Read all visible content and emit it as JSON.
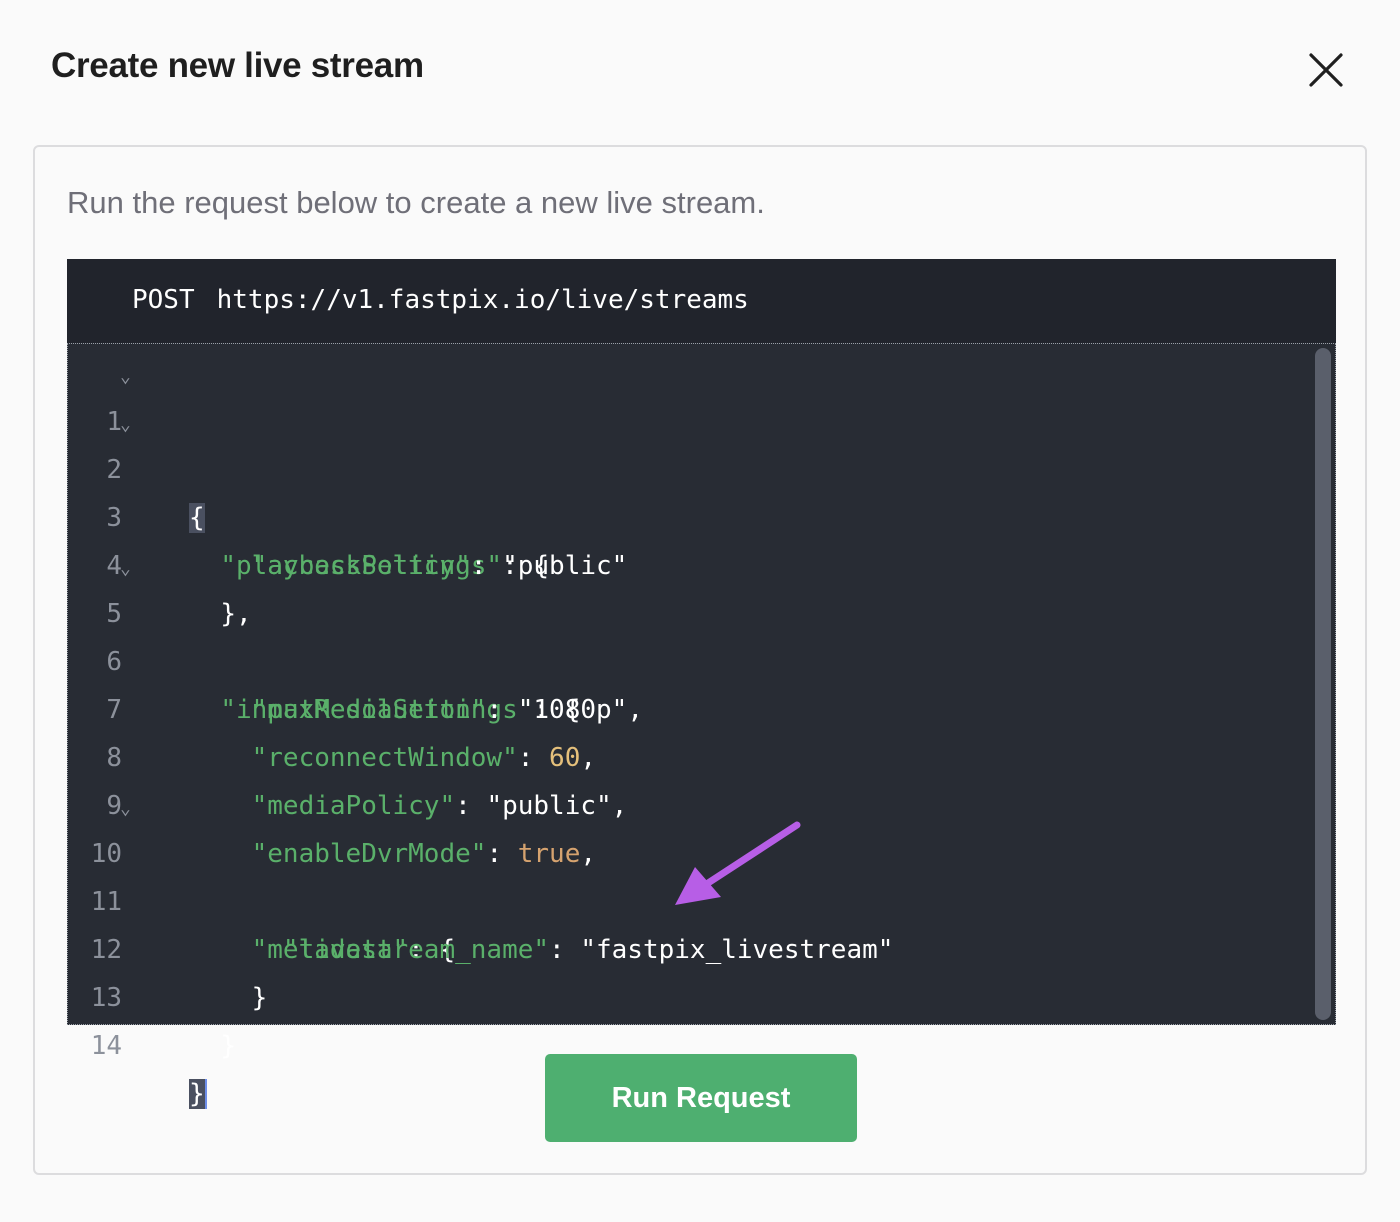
{
  "modal": {
    "title": "Create new live stream",
    "close_icon": "close-icon"
  },
  "panel": {
    "subtitle": "Run the request below to create a new live stream."
  },
  "request": {
    "method": "POST",
    "url": "https://v1.fastpix.io/live/streams"
  },
  "code": {
    "lines": [
      {
        "num": "1",
        "fold": true
      },
      {
        "num": "2",
        "fold": true
      },
      {
        "num": "3",
        "fold": false
      },
      {
        "num": "4",
        "fold": false
      },
      {
        "num": "5",
        "fold": true
      },
      {
        "num": "6",
        "fold": false
      },
      {
        "num": "7",
        "fold": false
      },
      {
        "num": "8",
        "fold": false
      },
      {
        "num": "9",
        "fold": false
      },
      {
        "num": "10",
        "fold": true
      },
      {
        "num": "11",
        "fold": false
      },
      {
        "num": "12",
        "fold": false
      },
      {
        "num": "13",
        "fold": false
      },
      {
        "num": "14",
        "fold": false
      }
    ],
    "tokens": {
      "open_brace": "{",
      "close_brace": "}",
      "playbackSettings_key": "\"playbackSettings\"",
      "accessPolicy_key": "\"accessPolicy\"",
      "accessPolicy_val": "\"public\"",
      "inputMediaSettings_key": "\"inputMediaSettings\"",
      "maxResolution_key": "\"maxResolution\"",
      "maxResolution_val": "\"1080p\"",
      "reconnectWindow_key": "\"reconnectWindow\"",
      "reconnectWindow_val": "60",
      "mediaPolicy_key": "\"mediaPolicy\"",
      "mediaPolicy_val": "\"public\"",
      "enableDvrMode_key": "\"enableDvrMode\"",
      "enableDvrMode_val": "true",
      "metadata_key": "\"metadata\"",
      "livestream_name_key": "\"livestream_name\"",
      "livestream_name_val": "\"fastpix_livestream\""
    }
  },
  "actions": {
    "run_label": "Run Request"
  },
  "colors": {
    "accent_green": "#4eaf70",
    "annotation_arrow": "#b75ee6",
    "editor_bg": "#282c34",
    "json_key": "#5ab06a"
  }
}
